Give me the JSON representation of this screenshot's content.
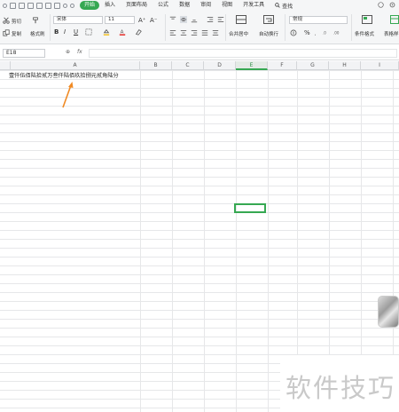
{
  "menubar": {
    "tabs": [
      "开始",
      "插入",
      "页面布局",
      "公式",
      "数据",
      "审阅",
      "视图",
      "开发工具"
    ],
    "active_tab": "开始",
    "search_label": "查找"
  },
  "ribbon": {
    "cut_label": "剪切",
    "copy_label": "复制",
    "format_painter_label": "格式刷",
    "font_name": "宋体",
    "font_size": "11",
    "font_grow": "A⁺",
    "font_shrink": "A⁻",
    "bold": "B",
    "italic": "I",
    "underline": "U",
    "merge_center_label": "合并居中",
    "wrap_text_label": "自动换行",
    "number_format": "常规",
    "percent": "%",
    "cond_format_label": "条件格式",
    "table_style_label": "表格样"
  },
  "formulabar": {
    "name_box": "E18",
    "fx_label": "fx",
    "zoom_icon_label": "⊕",
    "formula_value": ""
  },
  "grid": {
    "columns": [
      "A",
      "B",
      "C",
      "D",
      "E",
      "F",
      "G",
      "H",
      "I"
    ],
    "selected_column": "E",
    "a1_text": "壹仟伍佰陆拾贰万叁仟陆佰玖拾捌元贰角陆分",
    "active_cell": "E18"
  },
  "watermark": "软件技巧",
  "colors": {
    "accent_green": "#36a852",
    "ribbon_bg": "#f5f6f7",
    "arrow_orange": "#f08a24"
  }
}
